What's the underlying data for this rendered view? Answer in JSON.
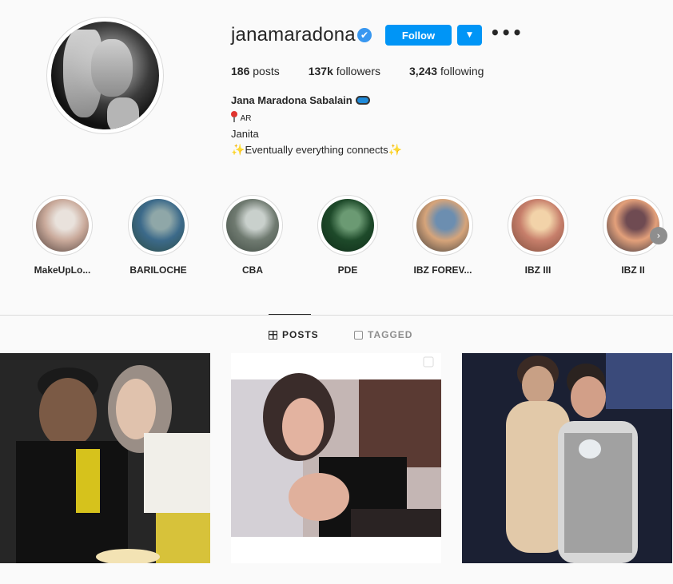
{
  "profile": {
    "username": "janamaradona",
    "verified_mark": "✔",
    "follow_label": "Follow",
    "dropdown_label": "▼",
    "more_label": "•••",
    "stats": {
      "posts_count": "186",
      "posts_label": "posts",
      "followers_count": "137k",
      "followers_label": "followers",
      "following_count": "3,243",
      "following_label": "following"
    },
    "full_name": "Jana Maradona Sabalain",
    "bio": {
      "line1": "AR",
      "line2": "Janita",
      "line3": "Eventually everything connects"
    }
  },
  "highlights": [
    {
      "label": "MakeUpLo...",
      "colors": [
        "#c9a99a",
        "#e9e2dc",
        "#4b3d39"
      ]
    },
    {
      "label": "BARILOCHE",
      "colors": [
        "#3c6a8a",
        "#8fa7a8",
        "#2c4a3e"
      ]
    },
    {
      "label": "CBA",
      "colors": [
        "#6f7a70",
        "#c9d0cc",
        "#3f4a42"
      ]
    },
    {
      "label": "PDE",
      "colors": [
        "#1e4a2a",
        "#6b9a73",
        "#0e2a17"
      ]
    },
    {
      "label": "IBZ FOREV...",
      "colors": [
        "#d6a47a",
        "#6c8eb0",
        "#3a3a3a"
      ]
    },
    {
      "label": "IBZ III",
      "colors": [
        "#c77f6b",
        "#f2d3a9",
        "#7a4b3a"
      ]
    },
    {
      "label": "IBZ II",
      "colors": [
        "#e3a07a",
        "#6f4b52",
        "#2c2c3a"
      ]
    }
  ],
  "tabs": {
    "posts": "POSTS",
    "tagged": "TAGGED"
  },
  "icons": {
    "verified": "verified-badge-icon",
    "more": "more-options-icon",
    "next": "chevron-right-icon",
    "grid": "grid-icon",
    "tagged": "tagged-icon"
  },
  "colors": {
    "accent": "#0095f6",
    "verified": "#3897f0",
    "text": "#262626",
    "muted": "#8e8e8e",
    "border": "#dbdbdb"
  }
}
